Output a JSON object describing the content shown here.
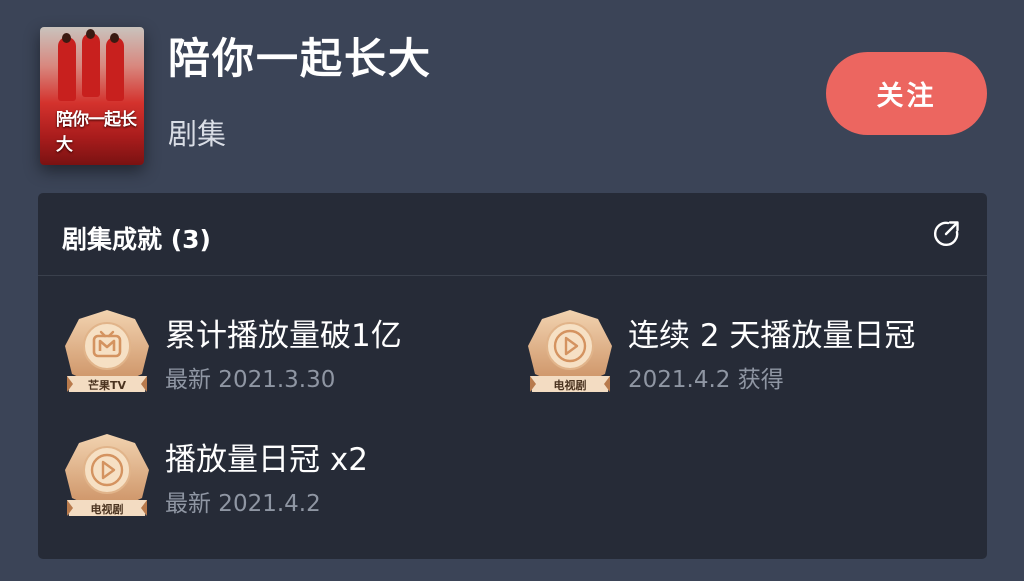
{
  "show": {
    "title": "陪你一起长大",
    "category": "剧集",
    "poster_text": "陪你一起长大",
    "follow_label": "关注"
  },
  "achievements_section": {
    "title": "剧集成就 (3)",
    "share_icon": "share-icon",
    "items": [
      {
        "name": "累计播放量破1亿",
        "date": "最新 2021.3.30",
        "badge": "芒果TV",
        "icon": "mango-tv-logo-icon"
      },
      {
        "name": "连续 2 天播放量日冠",
        "date": "2021.4.2 获得",
        "badge": "电视剧",
        "icon": "play-icon"
      },
      {
        "name": "播放量日冠 x2",
        "date": "最新 2021.4.2",
        "badge": "电视剧",
        "icon": "play-icon"
      }
    ]
  },
  "colors": {
    "background": "#3b4457",
    "card": "#262b37",
    "follow_button": "#ec6660",
    "badge_gold": "#d9a57a"
  }
}
